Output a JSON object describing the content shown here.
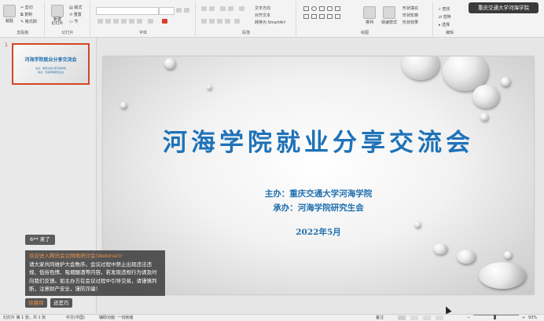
{
  "ribbon": {
    "clipboard": {
      "paste_label": "粘贴",
      "cut_label": "剪切",
      "copy_label": "复制",
      "format_painter_label": "格式刷",
      "group_label": "剪贴板"
    },
    "slides": {
      "new_slide_label": "新建\n幻灯片",
      "layout_label": "版式",
      "reset_label": "重置",
      "section_label": "节",
      "group_label": "幻灯片"
    },
    "font": {
      "group_label": "字体"
    },
    "paragraph": {
      "text_direction_label": "文字方向",
      "align_text_label": "对齐文本",
      "smartart_label": "转换为 SmartArt",
      "group_label": "段落"
    },
    "drawing": {
      "arrange_label": "排列",
      "quick_styles_label": "快速样式",
      "shape_fill_label": "形状填充",
      "shape_outline_label": "形状轮廓",
      "shape_effects_label": "形状效果",
      "group_label": "绘图"
    },
    "editing": {
      "find_label": "查找",
      "replace_label": "替换",
      "select_label": "选择",
      "group_label": "编辑"
    }
  },
  "window": {
    "user_badge": "重庆交通大学河海学院"
  },
  "slide_panel": {
    "thumbnail_number": "1",
    "thumb_title": "河海学院就业分享交流会"
  },
  "slide": {
    "title": "河海学院就业分享交流会",
    "organizer": "主办：重庆交通大学河海学院",
    "co_organizer": "承办：河海学院研究生会",
    "date": "2022年5月"
  },
  "chat": {
    "join_notice": "6** 来了",
    "notice_header": "欢迎进入腾讯会议网络研讨会(Webinar)!",
    "notice_body": "请大家共同维护大会秩序。会议过程中禁止出现违法违规、低俗色情、吸烟酗酒等内容，若发现违规行为请及时向我们反馈。如主办方在会议过程中引导交易，请谨慎判断，注意财产安全，谨防诈骗！",
    "sender": "徐晨晖",
    "message": "还是巧"
  },
  "status_bar": {
    "slide_counter": "幻灯片 第 1 张，共 1 张",
    "language": "中文(中国)",
    "accessibility": "辅助功能: 一切就绪",
    "notes_label": "备注",
    "zoom": "93%"
  },
  "colors": {
    "accent": "#d24726",
    "title_blue": "#1f72b8"
  }
}
